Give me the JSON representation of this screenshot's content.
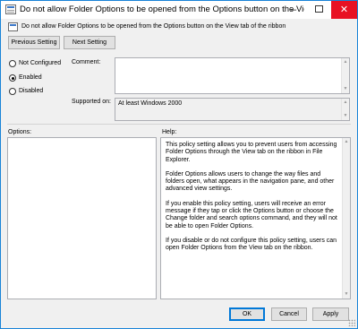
{
  "window": {
    "title": "Do not allow Folder Options to be opened from the Options button on the View ta...",
    "controls": {
      "minimize": "–",
      "maximize": "",
      "close": "✕"
    },
    "icon": "policy-window-icon"
  },
  "header": {
    "policy_title": "Do not allow Folder Options to be opened from the Options button on the View tab of the ribbon",
    "icon": "policy-icon"
  },
  "nav": {
    "previous_label": "Previous Setting",
    "next_label": "Next Setting"
  },
  "state": {
    "options": [
      {
        "label": "Not Configured",
        "selected": false
      },
      {
        "label": "Enabled",
        "selected": true
      },
      {
        "label": "Disabled",
        "selected": false
      }
    ]
  },
  "comment": {
    "label": "Comment:",
    "value": ""
  },
  "supported": {
    "label": "Supported on:",
    "value": "At least Windows 2000"
  },
  "options_section": {
    "label": "Options:"
  },
  "help_section": {
    "label": "Help:",
    "paragraphs": [
      "This policy setting allows you to prevent users from accessing Folder Options through the View tab on the ribbon in File Explorer.",
      "Folder Options allows users to change the way files and folders open, what appears in the navigation pane, and other advanced view settings.",
      "If you enable this policy setting, users will receive an error message if they tap or click the Options button or choose the Change folder and search options command, and they will not be able to open Folder Options.",
      "If you disable or do not configure this policy setting, users can open Folder Options from the View tab on the ribbon."
    ]
  },
  "footer": {
    "ok_label": "OK",
    "cancel_label": "Cancel",
    "apply_label": "Apply"
  },
  "colors": {
    "close_button": "#e81123",
    "window_border": "#1883d7",
    "dialog_background": "#f0f0f0"
  }
}
